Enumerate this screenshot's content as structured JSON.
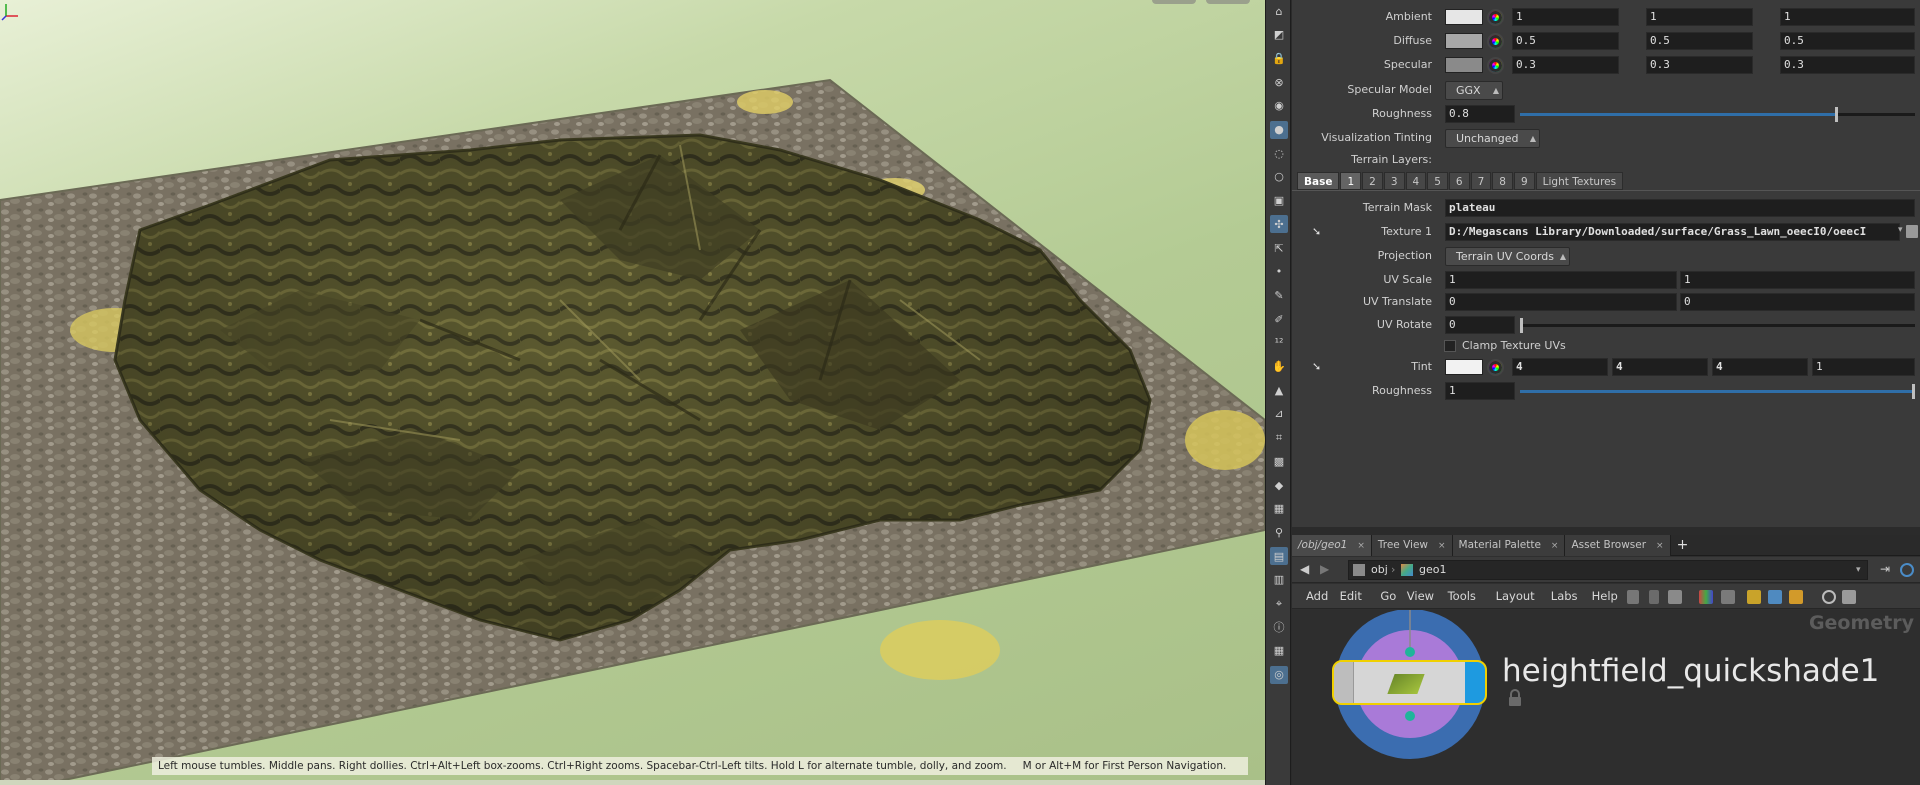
{
  "viewport": {
    "help_text_1": "Left mouse tumbles. Middle pans. Right dollies. Ctrl+Alt+Left box-zooms. Ctrl+Right zooms. Spacebar-Ctrl-Left tilts. Hold L for alternate tumble, dolly, and zoom.",
    "help_text_2": "M or Alt+M for First Person Navigation.",
    "background_top": "#e8f0d6",
    "background_bottom": "#a9c088"
  },
  "shelf_icons": [
    "pose-icon",
    "view-icon",
    "lock-icon",
    "cancel-icon",
    "camera-icon",
    "light-icon",
    "bulb-icon",
    "bulb-outline-icon",
    "render-icon",
    "handle-icon",
    "select-icon",
    "point-icon",
    "brush-icon",
    "pen-icon",
    "number-icon",
    "hand-icon",
    "paint-icon",
    "measure-icon",
    "edge-icon",
    "grid-icon",
    "shape-icon",
    "color-icon",
    "rig-icon",
    "stack-icon",
    "snapshot-icon",
    "pin-icon",
    "info-icon",
    "grid2-icon",
    "eye-icon"
  ],
  "material": {
    "ambient": {
      "label": "Ambient",
      "values": [
        "1",
        "1",
        "1"
      ],
      "swatch": "#e6e6e6"
    },
    "diffuse": {
      "label": "Diffuse",
      "values": [
        "0.5",
        "0.5",
        "0.5"
      ],
      "swatch": "#a8a8a8"
    },
    "specular": {
      "label": "Specular",
      "values": [
        "0.3",
        "0.3",
        "0.3"
      ],
      "swatch": "#8a8a8a"
    },
    "specular_model": {
      "label": "Specular Model",
      "value": "GGX"
    },
    "roughness": {
      "label": "Roughness",
      "value": "0.8",
      "fraction": 0.8
    },
    "viz_tint": {
      "label": "Visualization Tinting",
      "value": "Unchanged"
    },
    "terrain_layers_label": "Terrain Layers:"
  },
  "layer_tabs": [
    "Base",
    "1",
    "2",
    "3",
    "4",
    "5",
    "6",
    "7",
    "8",
    "9",
    "Light Textures"
  ],
  "layer": {
    "terrain_mask": {
      "label": "Terrain Mask",
      "value": "plateau"
    },
    "texture1": {
      "label": "Texture 1",
      "value": "D:/Megascans Library/Downloaded/surface/Grass_Lawn_oeecI0/oeecI"
    },
    "projection": {
      "label": "Projection",
      "value": "Terrain UV Coords"
    },
    "uv_scale": {
      "label": "UV Scale",
      "values": [
        "1",
        "1"
      ]
    },
    "uv_translate": {
      "label": "UV Translate",
      "values": [
        "0",
        "0"
      ]
    },
    "uv_rotate": {
      "label": "UV Rotate",
      "value": "0",
      "fraction": 0.0
    },
    "clamp": {
      "label": "Clamp Texture UVs"
    },
    "tint": {
      "label": "Tint",
      "values": [
        "4",
        "4",
        "4",
        "1"
      ],
      "swatch": "#f2f2f2"
    },
    "roughness": {
      "label": "Roughness",
      "value": "1",
      "fraction": 1.0
    }
  },
  "network": {
    "tabs": [
      {
        "label": "/obj/geo1",
        "active": true
      },
      {
        "label": "Tree View",
        "active": false
      },
      {
        "label": "Material Palette",
        "active": false
      },
      {
        "label": "Asset Browser",
        "active": false
      }
    ],
    "path": [
      "obj",
      "geo1"
    ],
    "menus": [
      "Add",
      "Edit",
      "Go",
      "View",
      "Tools",
      "Layout",
      "Labs",
      "Help"
    ],
    "context": "Geometry",
    "node_name": "heightfield_quickshade1"
  }
}
